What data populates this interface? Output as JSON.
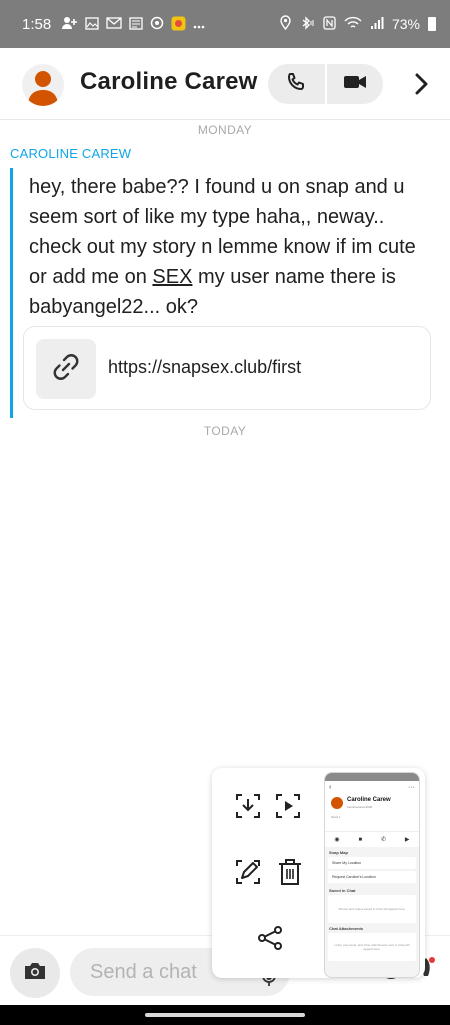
{
  "status_bar": {
    "time": "1:58",
    "left_icons": [
      "person-add-icon",
      "gallery-icon",
      "gmail-icon",
      "news-icon",
      "settings-icon",
      "app-icon",
      "more-icon"
    ],
    "battery": "73%"
  },
  "header": {
    "contact_name": "Caroline Carew",
    "call_icon": "phone-icon",
    "video_icon": "video-icon",
    "next_icon": "chevron-right-icon"
  },
  "chat": {
    "day_monday": "MONDAY",
    "sender": "CAROLINE CAREW",
    "message_part1": "hey, there babe?? I found u on snap and u seem sort of like my type haha,, neway.. check out my story n lemme know if im cute or add me on ",
    "message_underlined": "SEX",
    "message_part2": " my user name there is babyangel22... ok?",
    "link_url": "https://snapsex.club/first",
    "day_today": "TODAY"
  },
  "composer": {
    "placeholder": "Send a chat"
  },
  "screenshot_toolbar": {
    "buttons": [
      "download-icon",
      "play-icon",
      "edit-icon",
      "delete-icon",
      "share-icon"
    ],
    "thumbnail": {
      "name": "Caroline Carew",
      "sub": "carolinecarew1046",
      "sub2": "Send 1",
      "section_map": "Snap Map",
      "share_location": "Share My Location",
      "request_location": "Request Caroline's Location",
      "section_saved": "Saved in Chat",
      "saved_empty": "Photos and videos saved in Chat will appear here.",
      "section_attachments": "Chat Attachments",
      "attachments_empty": "Links, payments, and other attachments sent in Chat will appear here."
    }
  },
  "colors": {
    "accent_blue": "#0ea5e9",
    "status_bar": "#7d7d7d",
    "avatar_orange": "#d35400"
  }
}
